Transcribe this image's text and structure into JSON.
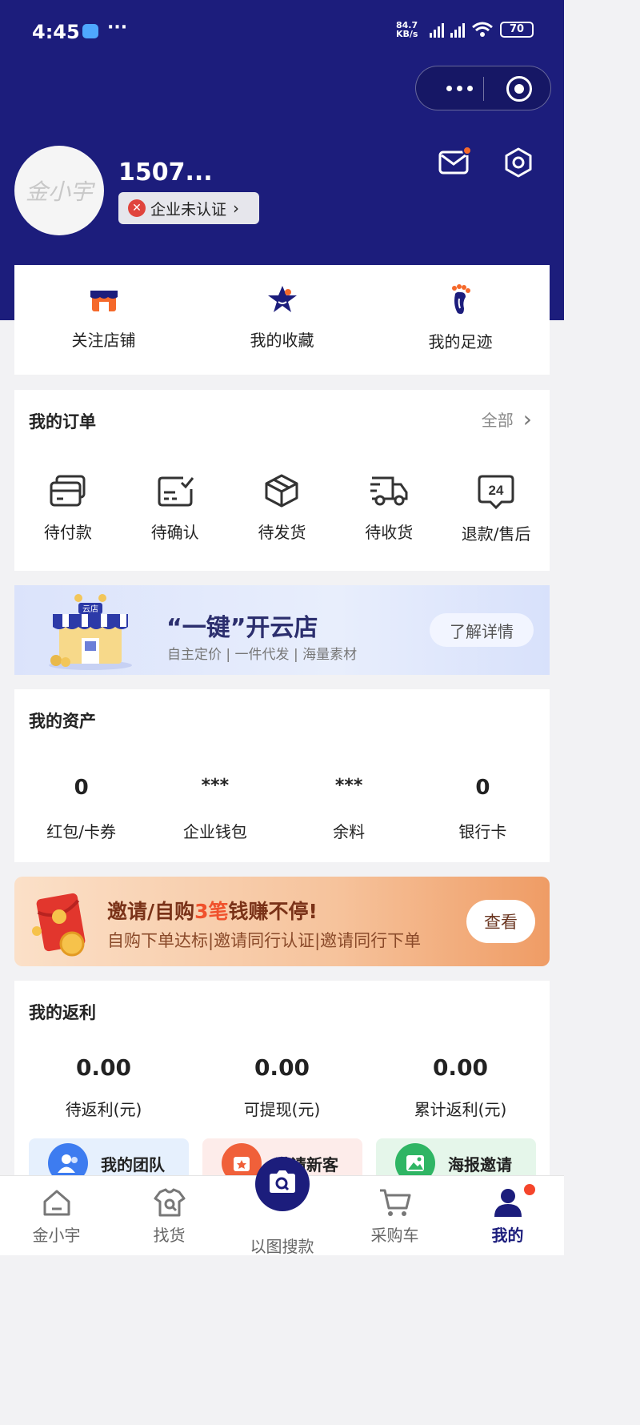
{
  "status_bar": {
    "time": "4:45",
    "net_speed": "84.7 KB/s",
    "battery": "70"
  },
  "profile": {
    "username": "1507...",
    "avatar_text": "金小宇",
    "cert_label": "企业未认证"
  },
  "quick_links": [
    {
      "label": "关注店铺",
      "icon": "store-icon"
    },
    {
      "label": "我的收藏",
      "icon": "star-icon"
    },
    {
      "label": "我的足迹",
      "icon": "footprint-icon"
    }
  ],
  "orders": {
    "title": "我的订单",
    "all_label": "全部",
    "items": [
      {
        "label": "待付款",
        "icon": "wallet-card-icon"
      },
      {
        "label": "待确认",
        "icon": "confirm-icon"
      },
      {
        "label": "待发货",
        "icon": "package-icon"
      },
      {
        "label": "待收货",
        "icon": "truck-icon"
      },
      {
        "label": "退款/售后",
        "icon": "aftersale-24-icon",
        "icon_text": "24"
      }
    ]
  },
  "banner_cloud_store": {
    "title": "“一键”开云店",
    "subtitle": "自主定价 | 一件代发 | 海量素材",
    "button": "了解详情",
    "shop_sign": "云店"
  },
  "assets": {
    "title": "我的资产",
    "items": [
      {
        "value": "0",
        "label": "红包/卡券"
      },
      {
        "value": "***",
        "label": "企业钱包"
      },
      {
        "value": "***",
        "label": "余料"
      },
      {
        "value": "0",
        "label": "银行卡"
      }
    ]
  },
  "banner_invite": {
    "title_pre": "邀请/自购",
    "title_highlight": "3笔",
    "title_post": "钱赚不停!",
    "subtitle": "自购下单达标|邀请同行认证|邀请同行下单",
    "button": "查看"
  },
  "rebate": {
    "title": "我的返利",
    "items": [
      {
        "value": "0.00",
        "label": "待返利(元)"
      },
      {
        "value": "0.00",
        "label": "可提现(元)"
      },
      {
        "value": "0.00",
        "label": "累计返利(元)"
      }
    ],
    "promos": [
      {
        "label": "我的团队",
        "color": "#3d7cf0"
      },
      {
        "label": "邀请新客",
        "color": "#f0603a"
      },
      {
        "label": "海报邀请",
        "color": "#2fb564"
      }
    ]
  },
  "tabbar": [
    {
      "label": "金小宇",
      "active": false
    },
    {
      "label": "找货",
      "active": false
    },
    {
      "label": "以图搜款",
      "active": false
    },
    {
      "label": "采购车",
      "active": false
    },
    {
      "label": "我的",
      "active": true
    }
  ],
  "colors": {
    "primary": "#1c1d7c",
    "accent_orange": "#f5692b",
    "text": "#222222",
    "muted": "#888888"
  }
}
